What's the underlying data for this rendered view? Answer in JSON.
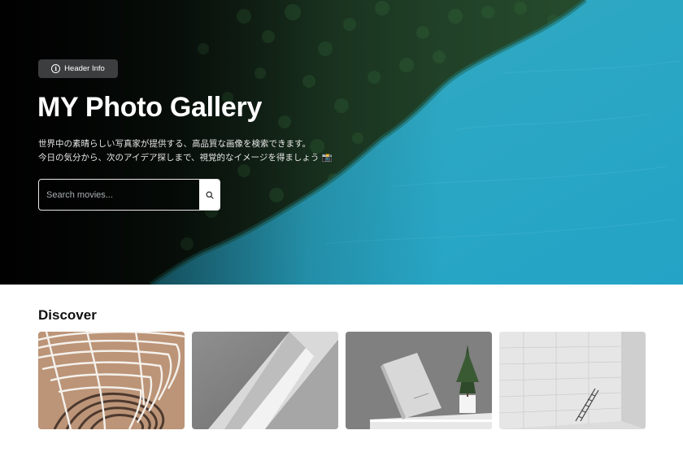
{
  "hero": {
    "badge_label": "Header Info",
    "badge_icon": "info-icon",
    "title": "MY Photo Gallery",
    "subtitle_line1": "世界中の素晴らしい写真家が提供する、高品質な画像を検索できます。",
    "subtitle_line2": "今日の気分から、次のアイデア探しまで、視覚的なイメージを得ましょう 📸",
    "background_image": "aerial-forest-and-lake",
    "colors": {
      "water": "#2aa7c4",
      "forest": "#1c3a22"
    }
  },
  "search": {
    "placeholder": "Search movies...",
    "value": "",
    "button_icon": "search-icon"
  },
  "discover": {
    "title": "Discover",
    "cards": [
      {
        "image": "wire-chair-on-tan-background"
      },
      {
        "image": "white-geometric-shapes"
      },
      {
        "image": "white-book-with-potted-plant"
      },
      {
        "image": "white-wall-with-ladder"
      }
    ]
  }
}
